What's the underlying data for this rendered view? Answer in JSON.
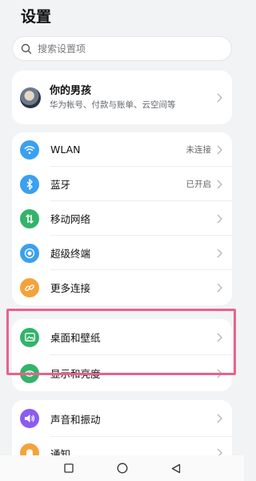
{
  "header": {
    "title": "设置"
  },
  "search": {
    "placeholder": "搜索设置项"
  },
  "account": {
    "name": "你的男孩",
    "subtitle": "华为帐号、付款与账单、云空间等"
  },
  "network": {
    "items": [
      {
        "label": "WLAN",
        "status": "未连接",
        "icon": "wifi-icon",
        "color": "#3aa0f0"
      },
      {
        "label": "蓝牙",
        "status": "已开启",
        "icon": "bluetooth-icon",
        "color": "#3aa0f0"
      },
      {
        "label": "移动网络",
        "status": "",
        "icon": "mobile-data-icon",
        "color": "#34b36a"
      },
      {
        "label": "超级终端",
        "status": "",
        "icon": "super-device-icon",
        "color": "#3aa0f0"
      },
      {
        "label": "更多连接",
        "status": "",
        "icon": "link-icon",
        "color": "#f3a33a"
      }
    ]
  },
  "display": {
    "items": [
      {
        "label": "桌面和壁纸",
        "icon": "wallpaper-icon",
        "color": "#34b36a"
      },
      {
        "label": "显示和亮度",
        "icon": "eye-icon",
        "color": "#34b36a"
      }
    ]
  },
  "sound": {
    "items": [
      {
        "label": "声音和振动",
        "icon": "speaker-icon",
        "color": "#8a5cf0"
      },
      {
        "label": "通知",
        "icon": "bell-icon",
        "color": "#f3a33a"
      }
    ]
  },
  "colors": {
    "highlight": "#e8638c",
    "background": "#f1f3f5"
  }
}
